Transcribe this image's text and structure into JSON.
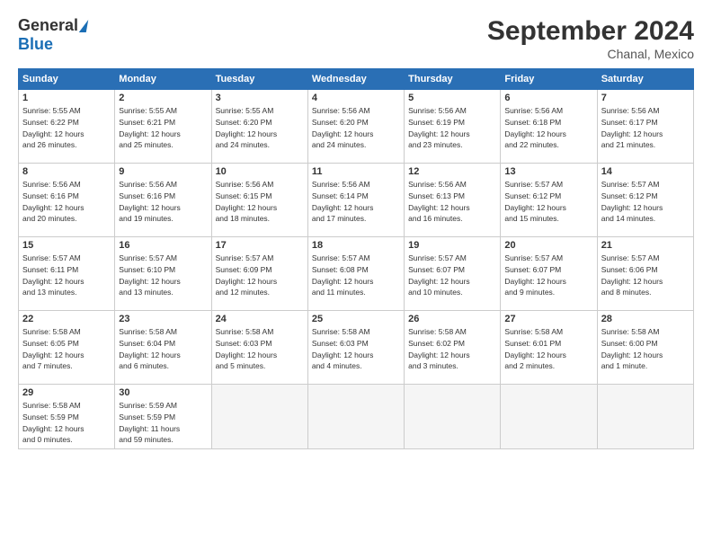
{
  "header": {
    "logo_general": "General",
    "logo_blue": "Blue",
    "month_title": "September 2024",
    "subtitle": "Chanal, Mexico"
  },
  "weekdays": [
    "Sunday",
    "Monday",
    "Tuesday",
    "Wednesday",
    "Thursday",
    "Friday",
    "Saturday"
  ],
  "weeks": [
    [
      {
        "day": "1",
        "info": "Sunrise: 5:55 AM\nSunset: 6:22 PM\nDaylight: 12 hours\nand 26 minutes."
      },
      {
        "day": "2",
        "info": "Sunrise: 5:55 AM\nSunset: 6:21 PM\nDaylight: 12 hours\nand 25 minutes."
      },
      {
        "day": "3",
        "info": "Sunrise: 5:55 AM\nSunset: 6:20 PM\nDaylight: 12 hours\nand 24 minutes."
      },
      {
        "day": "4",
        "info": "Sunrise: 5:56 AM\nSunset: 6:20 PM\nDaylight: 12 hours\nand 24 minutes."
      },
      {
        "day": "5",
        "info": "Sunrise: 5:56 AM\nSunset: 6:19 PM\nDaylight: 12 hours\nand 23 minutes."
      },
      {
        "day": "6",
        "info": "Sunrise: 5:56 AM\nSunset: 6:18 PM\nDaylight: 12 hours\nand 22 minutes."
      },
      {
        "day": "7",
        "info": "Sunrise: 5:56 AM\nSunset: 6:17 PM\nDaylight: 12 hours\nand 21 minutes."
      }
    ],
    [
      {
        "day": "8",
        "info": "Sunrise: 5:56 AM\nSunset: 6:16 PM\nDaylight: 12 hours\nand 20 minutes."
      },
      {
        "day": "9",
        "info": "Sunrise: 5:56 AM\nSunset: 6:16 PM\nDaylight: 12 hours\nand 19 minutes."
      },
      {
        "day": "10",
        "info": "Sunrise: 5:56 AM\nSunset: 6:15 PM\nDaylight: 12 hours\nand 18 minutes."
      },
      {
        "day": "11",
        "info": "Sunrise: 5:56 AM\nSunset: 6:14 PM\nDaylight: 12 hours\nand 17 minutes."
      },
      {
        "day": "12",
        "info": "Sunrise: 5:56 AM\nSunset: 6:13 PM\nDaylight: 12 hours\nand 16 minutes."
      },
      {
        "day": "13",
        "info": "Sunrise: 5:57 AM\nSunset: 6:12 PM\nDaylight: 12 hours\nand 15 minutes."
      },
      {
        "day": "14",
        "info": "Sunrise: 5:57 AM\nSunset: 6:12 PM\nDaylight: 12 hours\nand 14 minutes."
      }
    ],
    [
      {
        "day": "15",
        "info": "Sunrise: 5:57 AM\nSunset: 6:11 PM\nDaylight: 12 hours\nand 13 minutes."
      },
      {
        "day": "16",
        "info": "Sunrise: 5:57 AM\nSunset: 6:10 PM\nDaylight: 12 hours\nand 13 minutes."
      },
      {
        "day": "17",
        "info": "Sunrise: 5:57 AM\nSunset: 6:09 PM\nDaylight: 12 hours\nand 12 minutes."
      },
      {
        "day": "18",
        "info": "Sunrise: 5:57 AM\nSunset: 6:08 PM\nDaylight: 12 hours\nand 11 minutes."
      },
      {
        "day": "19",
        "info": "Sunrise: 5:57 AM\nSunset: 6:07 PM\nDaylight: 12 hours\nand 10 minutes."
      },
      {
        "day": "20",
        "info": "Sunrise: 5:57 AM\nSunset: 6:07 PM\nDaylight: 12 hours\nand 9 minutes."
      },
      {
        "day": "21",
        "info": "Sunrise: 5:57 AM\nSunset: 6:06 PM\nDaylight: 12 hours\nand 8 minutes."
      }
    ],
    [
      {
        "day": "22",
        "info": "Sunrise: 5:58 AM\nSunset: 6:05 PM\nDaylight: 12 hours\nand 7 minutes."
      },
      {
        "day": "23",
        "info": "Sunrise: 5:58 AM\nSunset: 6:04 PM\nDaylight: 12 hours\nand 6 minutes."
      },
      {
        "day": "24",
        "info": "Sunrise: 5:58 AM\nSunset: 6:03 PM\nDaylight: 12 hours\nand 5 minutes."
      },
      {
        "day": "25",
        "info": "Sunrise: 5:58 AM\nSunset: 6:03 PM\nDaylight: 12 hours\nand 4 minutes."
      },
      {
        "day": "26",
        "info": "Sunrise: 5:58 AM\nSunset: 6:02 PM\nDaylight: 12 hours\nand 3 minutes."
      },
      {
        "day": "27",
        "info": "Sunrise: 5:58 AM\nSunset: 6:01 PM\nDaylight: 12 hours\nand 2 minutes."
      },
      {
        "day": "28",
        "info": "Sunrise: 5:58 AM\nSunset: 6:00 PM\nDaylight: 12 hours\nand 1 minute."
      }
    ],
    [
      {
        "day": "29",
        "info": "Sunrise: 5:58 AM\nSunset: 5:59 PM\nDaylight: 12 hours\nand 0 minutes."
      },
      {
        "day": "30",
        "info": "Sunrise: 5:59 AM\nSunset: 5:59 PM\nDaylight: 11 hours\nand 59 minutes."
      },
      {
        "day": "",
        "info": ""
      },
      {
        "day": "",
        "info": ""
      },
      {
        "day": "",
        "info": ""
      },
      {
        "day": "",
        "info": ""
      },
      {
        "day": "",
        "info": ""
      }
    ]
  ]
}
